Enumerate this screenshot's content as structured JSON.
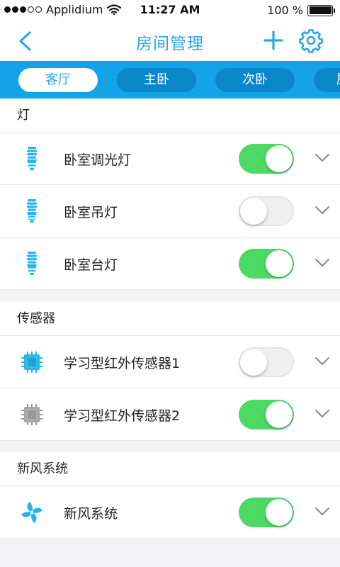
{
  "status_bar": {
    "carrier": "Applidium",
    "time": "11:27 AM",
    "battery_text": "100 %",
    "battery_level": 1.0,
    "signal_bars_filled": 3,
    "signal_bars_total": 5
  },
  "nav": {
    "back_icon": "chevron-left-icon",
    "title": "房间管理",
    "add_icon": "plus-icon",
    "settings_icon": "gear-icon"
  },
  "tabs": [
    {
      "label": "客厅",
      "active": true
    },
    {
      "label": "主卧",
      "active": false
    },
    {
      "label": "次卧",
      "active": false
    },
    {
      "label": "厨",
      "active": false
    }
  ],
  "sections": [
    {
      "title": "灯",
      "items": [
        {
          "label": "卧室调光灯",
          "icon": "bulb-icon",
          "on": true
        },
        {
          "label": "卧室吊灯",
          "icon": "bulb-icon",
          "on": false
        },
        {
          "label": "卧室台灯",
          "icon": "bulb-icon",
          "on": true
        }
      ]
    },
    {
      "title": "传感器",
      "items": [
        {
          "label": "学习型红外传感器1",
          "icon": "chip-icon",
          "on": false
        },
        {
          "label": "学习型红外传感器2",
          "icon": "chip-gray-icon",
          "on": true
        }
      ]
    },
    {
      "title": "新风系统",
      "items": [
        {
          "label": "新风系统",
          "icon": "fan-icon",
          "on": true
        }
      ]
    }
  ],
  "colors": {
    "accent": "#2aa7e8",
    "tab_strip": "#14a3e6",
    "tab_inactive": "#0b86c9",
    "toggle_on": "#4cd964",
    "toggle_off": "#efefef",
    "background": "#f3f3f5"
  }
}
